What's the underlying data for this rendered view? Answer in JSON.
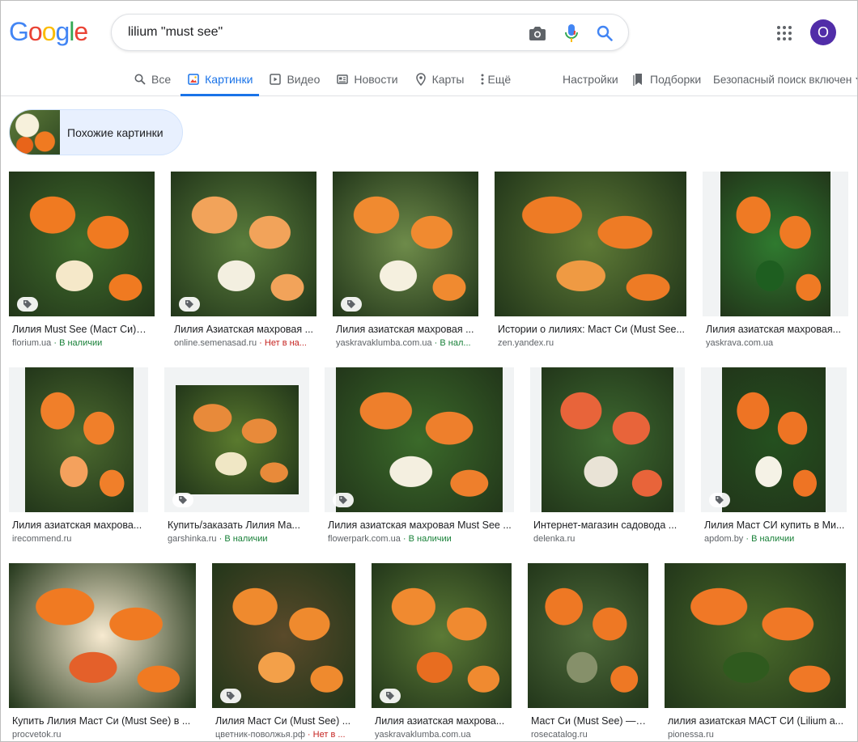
{
  "search": {
    "query": "lilium \"must see\""
  },
  "logo": [
    "G",
    "o",
    "o",
    "g",
    "l",
    "e"
  ],
  "logo_colors": [
    "#4285f4",
    "#ea4335",
    "#fbbc05",
    "#4285f4",
    "#34a853",
    "#ea4335"
  ],
  "user": {
    "initial": "O",
    "color": "#512da8"
  },
  "tabs": [
    {
      "label": "Все",
      "icon": "search-icon"
    },
    {
      "label": "Картинки",
      "icon": "image-icon",
      "active": true
    },
    {
      "label": "Видео",
      "icon": "video-icon"
    },
    {
      "label": "Новости",
      "icon": "news-icon"
    },
    {
      "label": "Карты",
      "icon": "map-pin-icon"
    },
    {
      "label": "Ещё",
      "icon": "more-vert-icon"
    }
  ],
  "tools": {
    "settings": "Настройки",
    "collections": "Подборки",
    "safesearch": "Безопасный поиск включен"
  },
  "related": {
    "label": "Похожие картинки"
  },
  "results": [
    {
      "title": "Лилия Must See (Маст Си)🌷...",
      "source": "florium.ua",
      "avail": " · В наличии",
      "status": "ok"
    },
    {
      "title": "Лилия Азиатская махровая ...",
      "source": "online.semenasad.ru",
      "avail": " · Нет в на...",
      "status": "no"
    },
    {
      "title": "Лилия азиатская махровая ...",
      "source": "yaskravaklumba.com.ua",
      "avail": " · В нал...",
      "status": "ok"
    },
    {
      "title": "Истории о лилиях: Маст Си (Must See...",
      "source": "zen.yandex.ru",
      "avail": "",
      "status": ""
    },
    {
      "title": "Лилия азиатская махровая...",
      "source": "yaskrava.com.ua",
      "avail": "",
      "status": ""
    },
    {
      "title": "Лилия азиатская махрова...",
      "source": "irecommend.ru",
      "avail": "",
      "status": ""
    },
    {
      "title": "Купить/заказать Лилия Ма...",
      "source": "garshinka.ru",
      "avail": " · В наличии",
      "status": "ok"
    },
    {
      "title": "Лилия азиатская махровая Must See ...",
      "source": "flowerpark.com.ua",
      "avail": " · В наличии",
      "status": "ok"
    },
    {
      "title": "Интернет-магазин садовода ...",
      "source": "delenka.ru",
      "avail": "",
      "status": ""
    },
    {
      "title": "Лилия Маст СИ купить в Ми...",
      "source": "apdom.by",
      "avail": " · В наличии",
      "status": "ok"
    },
    {
      "title": "Купить Лилия Маст Си (Must See) в ...",
      "source": "procvetok.ru",
      "avail": "",
      "status": ""
    },
    {
      "title": "Лилия Маст Си (Must See) ...",
      "source": "цветник-поволжья.рф",
      "avail": " · Нет в ...",
      "status": "no"
    },
    {
      "title": "Лилия азиатская махрова...",
      "source": "yaskravaklumba.com.ua",
      "avail": "",
      "status": ""
    },
    {
      "title": "Маст Си (Must See) — ...",
      "source": "rosecatalog.ru",
      "avail": "",
      "status": ""
    },
    {
      "title": "лилия азиатская МАСТ СИ (Lilium a...",
      "source": "pionessa.ru",
      "avail": "",
      "status": ""
    }
  ]
}
